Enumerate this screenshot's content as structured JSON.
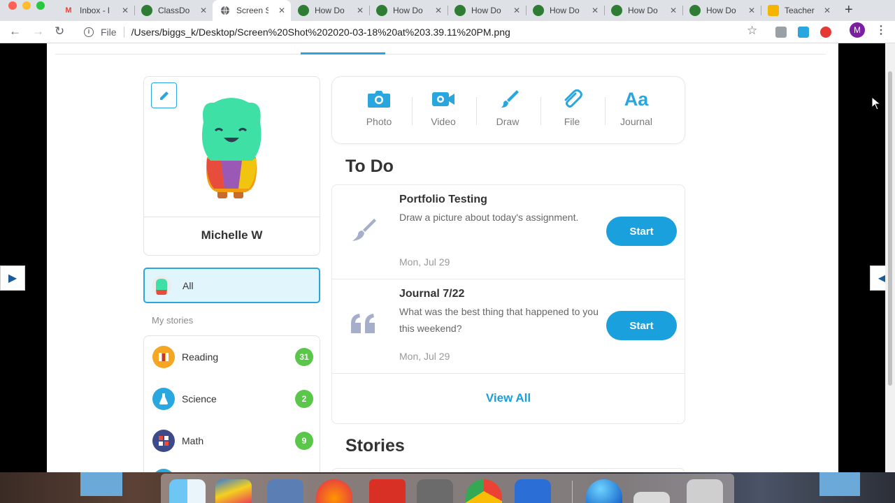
{
  "browser": {
    "tabs": [
      {
        "title": "Inbox - l",
        "favicon": "gmail-icon",
        "color": "#ea4335"
      },
      {
        "title": "ClassDo",
        "favicon": "classdojo-icon",
        "color": "#2e7d32"
      },
      {
        "title": "Screen S",
        "favicon": "globe-icon",
        "color": "#5f6368"
      },
      {
        "title": "How Do",
        "favicon": "classdojo-icon",
        "color": "#2e7d32"
      },
      {
        "title": "How Do",
        "favicon": "classdojo-icon",
        "color": "#2e7d32"
      },
      {
        "title": "How Do",
        "favicon": "classdojo-icon",
        "color": "#2e7d32"
      },
      {
        "title": "How Do",
        "favicon": "classdojo-icon",
        "color": "#2e7d32"
      },
      {
        "title": "How Do",
        "favicon": "classdojo-icon",
        "color": "#2e7d32"
      },
      {
        "title": "How Do",
        "favicon": "classdojo-icon",
        "color": "#2e7d32"
      },
      {
        "title": "Teacher",
        "favicon": "slides-icon",
        "color": "#f4b400"
      }
    ],
    "active_tab_index": 2,
    "url_scheme": "File",
    "url": "/Users/biggs_k/Desktop/Screen%20Shot%202020-03-18%20at%203.39.11%20PM.png",
    "profile_initial": "M"
  },
  "profile": {
    "name": "Michelle W"
  },
  "filter": {
    "all_label": "All",
    "my_stories_label": "My stories"
  },
  "stories": [
    {
      "label": "Reading",
      "count": "31",
      "icon": "books-icon",
      "color": "#f5a623"
    },
    {
      "label": "Science",
      "count": "2",
      "icon": "flask-icon",
      "color": "#29a8df"
    },
    {
      "label": "Math",
      "count": "9",
      "icon": "calculator-icon",
      "color": "#3d4a8a"
    }
  ],
  "actions": [
    {
      "label": "Photo",
      "icon": "camera-icon"
    },
    {
      "label": "Video",
      "icon": "video-camera-icon"
    },
    {
      "label": "Draw",
      "icon": "paintbrush-icon"
    },
    {
      "label": "File",
      "icon": "paperclip-icon"
    },
    {
      "label": "Journal",
      "icon": "text-aa-icon",
      "glyph": "Aa"
    }
  ],
  "todo": {
    "heading": "To Do",
    "items": [
      {
        "title": "Portfolio Testing",
        "description": "Draw a picture about today's assignment.",
        "date": "Mon, Jul 29",
        "button": "Start",
        "icon": "paintbrush-icon"
      },
      {
        "title": "Journal 7/22",
        "description": "What was the best thing that happened to you this weekend?",
        "date": "Mon, Jul 29",
        "button": "Start",
        "icon": "quote-icon"
      }
    ],
    "view_all": "View All"
  },
  "stories_heading": "Stories",
  "colors": {
    "accent": "#1aa0dc",
    "badge_green": "#5ac64a",
    "selected_bg": "#e0f6fc"
  }
}
